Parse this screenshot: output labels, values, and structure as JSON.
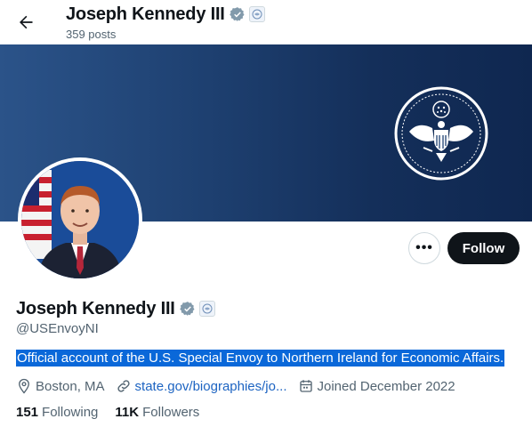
{
  "header": {
    "name": "Joseph Kennedy III",
    "posts_count": "359 posts"
  },
  "profile": {
    "display_name": "Joseph Kennedy III",
    "handle": "@USEnvoyNI",
    "bio": "Official account of the U.S. Special Envoy to Northern Ireland for Economic Affairs.",
    "location": "Boston, MA",
    "website": "state.gov/biographies/jo...",
    "joined": "Joined December 2022",
    "following_count": "151",
    "following_label": "Following",
    "followers_count": "11K",
    "followers_label": "Followers"
  },
  "actions": {
    "more_label": "•••",
    "follow_label": "Follow"
  },
  "icons": {
    "back": "arrow-left-icon",
    "verified": "verified-badge-icon",
    "affiliate": "state-department-seal-icon",
    "location": "location-pin-icon",
    "link": "link-icon",
    "calendar": "calendar-icon"
  },
  "colors": {
    "banner": "#1f4273",
    "follow_button": "#0f1419",
    "link": "#1d64c2",
    "selection": "#0a68d9",
    "secondary_text": "#536471"
  }
}
